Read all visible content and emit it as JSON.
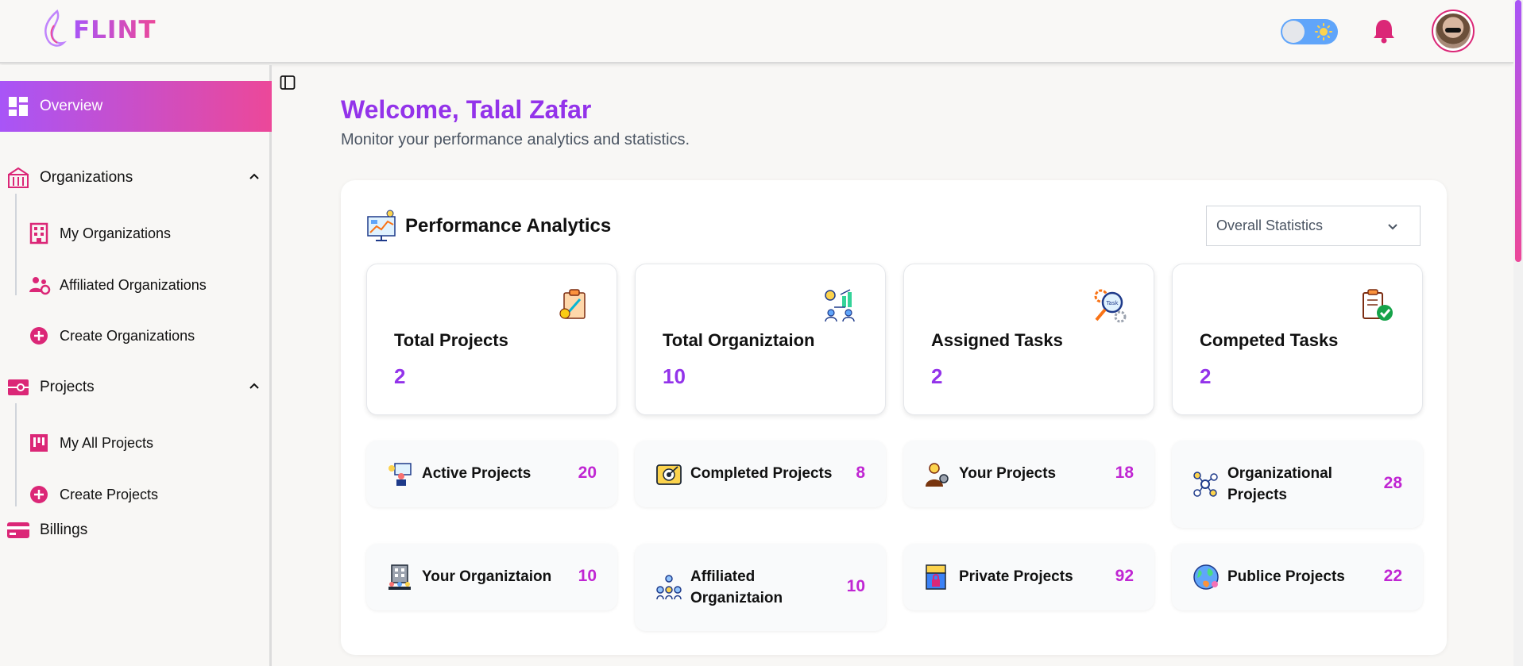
{
  "brand": {
    "name": "FLINT"
  },
  "header": {
    "theme_toggle_icon": "sun-icon",
    "notification_icon": "bell-icon",
    "avatar_icon": "user-avatar"
  },
  "sidebar": {
    "overview": "Overview",
    "organizations": {
      "label": "Organizations",
      "items": [
        {
          "label": "My Organizations",
          "icon": "building-icon"
        },
        {
          "label": "Affiliated Organizations",
          "icon": "users-gear-icon"
        },
        {
          "label": "Create Organizations",
          "icon": "plus-circle-icon"
        }
      ]
    },
    "projects": {
      "label": "Projects",
      "items": [
        {
          "label": "My All Projects",
          "icon": "kanban-icon"
        },
        {
          "label": "Create Projects",
          "icon": "plus-circle-icon"
        }
      ]
    },
    "billings": "Billings"
  },
  "main": {
    "welcome": "Welcome, Talal Zafar",
    "subtitle": "Monitor your performance analytics and statistics.",
    "panel_title": "Performance Analytics",
    "filter_selected": "Overall Statistics",
    "stats": [
      {
        "title": "Total Projects",
        "value": "2",
        "icon": "clipboard-icon"
      },
      {
        "title": "Total Organiztaion",
        "value": "10",
        "icon": "org-chart-icon"
      },
      {
        "title": "Assigned Tasks",
        "value": "2",
        "icon": "task-magnifier-icon"
      },
      {
        "title": "Competed Tasks",
        "value": "2",
        "icon": "clipboard-check-icon"
      }
    ],
    "tiles": [
      {
        "label": "Active Projects",
        "value": "20",
        "icon": "presenter-icon"
      },
      {
        "label": "Completed Projects",
        "value": "8",
        "icon": "target-icon"
      },
      {
        "label": "Your Projects",
        "value": "18",
        "icon": "person-gear-icon"
      },
      {
        "label": "Organizational Projects",
        "value": "28",
        "icon": "network-icon"
      },
      {
        "label": "Your Organiztaion",
        "value": "10",
        "icon": "building-people-icon"
      },
      {
        "label": "Affiliated Organiztaion",
        "value": "10",
        "icon": "team-network-icon"
      },
      {
        "label": "Private Projects",
        "value": "92",
        "icon": "lock-folder-icon"
      },
      {
        "label": "Publice Projects",
        "value": "22",
        "icon": "globe-icon"
      }
    ]
  },
  "colors": {
    "accent_purple": "#9333ea",
    "accent_pink": "#ec4899",
    "value_magenta": "#c026d3"
  }
}
